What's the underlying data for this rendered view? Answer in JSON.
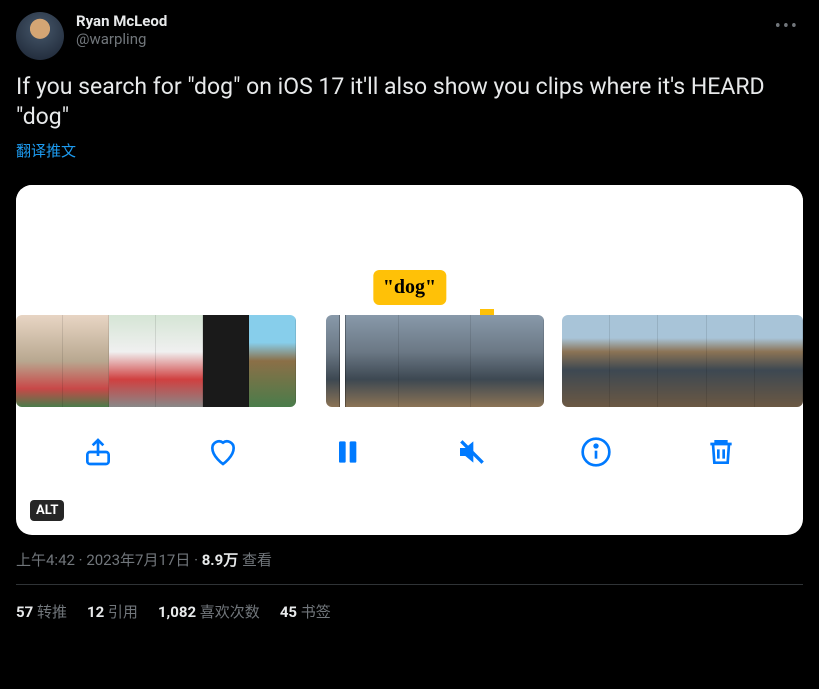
{
  "user": {
    "display_name": "Ryan McLeod",
    "handle": "@warpling"
  },
  "tweet": {
    "text": "If you search for \"dog\" on iOS 17 it'll also show you clips where it's HEARD \"dog\"",
    "translate_label": "翻译推文"
  },
  "media": {
    "dog_label": "\"dog\"",
    "alt_badge": "ALT",
    "controls": {
      "share": "share-icon",
      "like": "heart-icon",
      "pause": "pause-icon",
      "mute": "mute-icon",
      "info": "info-icon",
      "trash": "trash-icon"
    }
  },
  "meta": {
    "time": "上午4:42",
    "date": "2023年7月17日",
    "views_count": "8.9万",
    "views_label": "查看"
  },
  "stats": {
    "retweets_count": "57",
    "retweets_label": "转推",
    "quotes_count": "12",
    "quotes_label": "引用",
    "likes_count": "1,082",
    "likes_label": "喜欢次数",
    "bookmarks_count": "45",
    "bookmarks_label": "书签"
  }
}
